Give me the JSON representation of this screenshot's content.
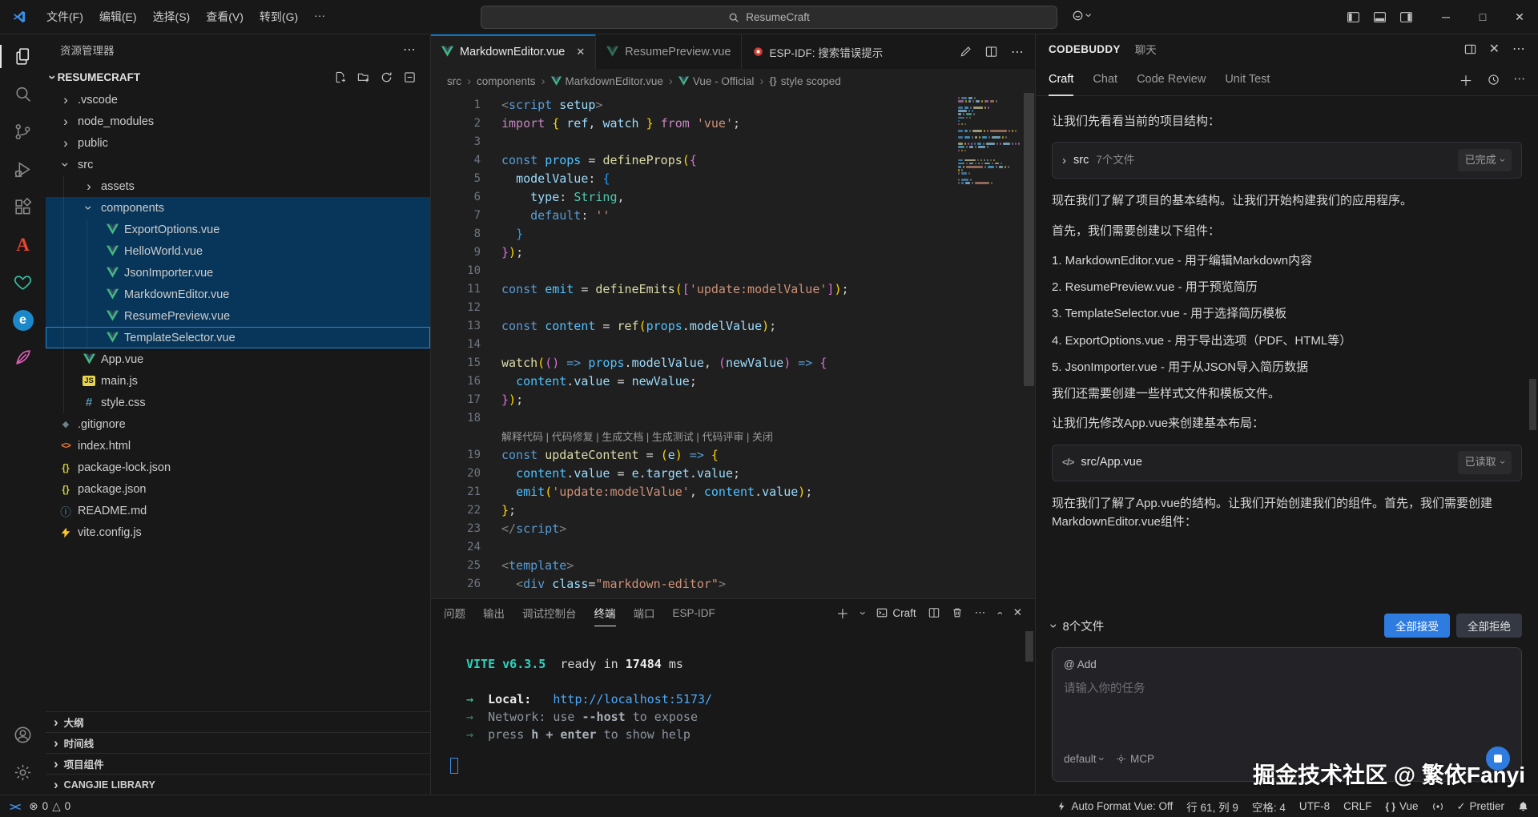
{
  "titlebar": {
    "menus": [
      "文件(F)",
      "编辑(E)",
      "选择(S)",
      "查看(V)",
      "转到(G)",
      "···"
    ],
    "search": "ResumeCraft"
  },
  "activity_bar": {
    "top": [
      {
        "name": "explorer",
        "active": true
      },
      {
        "name": "search"
      },
      {
        "name": "source-control"
      },
      {
        "name": "run-debug"
      },
      {
        "name": "extensions"
      },
      {
        "name": "tongyi-lingma"
      },
      {
        "name": "codebuddy"
      },
      {
        "name": "esp-idf"
      },
      {
        "name": "cangjie"
      }
    ],
    "bottom": [
      {
        "name": "account"
      },
      {
        "name": "settings"
      }
    ]
  },
  "sidebar": {
    "explorer_title": "资源管理器",
    "project": "RESUMECRAFT",
    "tree": [
      {
        "label": ".vscode",
        "type": "folder",
        "indent": 0
      },
      {
        "label": "node_modules",
        "type": "folder",
        "indent": 0
      },
      {
        "label": "public",
        "type": "folder",
        "indent": 0
      },
      {
        "label": "src",
        "type": "folder-open",
        "indent": 0
      },
      {
        "label": "assets",
        "type": "folder",
        "indent": 1
      },
      {
        "label": "components",
        "type": "folder-open",
        "indent": 1,
        "highlight": true
      },
      {
        "label": "ExportOptions.vue",
        "type": "vue",
        "indent": 2,
        "highlight": true
      },
      {
        "label": "HelloWorld.vue",
        "type": "vue",
        "indent": 2,
        "highlight": true
      },
      {
        "label": "JsonImporter.vue",
        "type": "vue",
        "indent": 2,
        "highlight": true
      },
      {
        "label": "MarkdownEditor.vue",
        "type": "vue",
        "indent": 2,
        "highlight": true
      },
      {
        "label": "ResumePreview.vue",
        "type": "vue",
        "indent": 2,
        "highlight": true
      },
      {
        "label": "TemplateSelector.vue",
        "type": "vue",
        "indent": 2,
        "highlight": true,
        "focused": true
      },
      {
        "label": "App.vue",
        "type": "vue",
        "indent": 1
      },
      {
        "label": "main.js",
        "type": "js",
        "indent": 1
      },
      {
        "label": "style.css",
        "type": "css",
        "indent": 1
      },
      {
        "label": ".gitignore",
        "type": "git",
        "indent": 0
      },
      {
        "label": "index.html",
        "type": "html",
        "indent": 0
      },
      {
        "label": "package-lock.json",
        "type": "json",
        "indent": 0
      },
      {
        "label": "package.json",
        "type": "json",
        "indent": 0
      },
      {
        "label": "README.md",
        "type": "info",
        "indent": 0
      },
      {
        "label": "vite.config.js",
        "type": "vite",
        "indent": 0
      }
    ],
    "sections": [
      "大纲",
      "时间线",
      "项目组件",
      "CANGJIE LIBRARY"
    ]
  },
  "editor": {
    "tabs": [
      {
        "label": "MarkdownEditor.vue",
        "active": true
      },
      {
        "label": "ResumePreview.vue",
        "active": false
      }
    ],
    "esp": "ESP-IDF: 搜索错误提示",
    "breadcrumb": [
      {
        "label": "src"
      },
      {
        "label": "components"
      },
      {
        "label": "MarkdownEditor.vue",
        "icon": "vue"
      },
      {
        "label": "Vue - Official",
        "icon": "vue"
      },
      {
        "label": "style scoped",
        "icon": "braces"
      }
    ],
    "code": [
      {
        "n": 1,
        "t": [
          [
            "p",
            "<"
          ],
          [
            "g",
            "script"
          ],
          [
            "a",
            " setup"
          ],
          [
            "p",
            ">"
          ]
        ]
      },
      {
        "n": 2,
        "t": [
          [
            "k",
            "import"
          ],
          [
            "w",
            " "
          ],
          [
            "G",
            "{"
          ],
          [
            "w",
            " "
          ],
          [
            "v",
            "ref"
          ],
          [
            "w",
            ", "
          ],
          [
            "v",
            "watch"
          ],
          [
            "w",
            " "
          ],
          [
            "G",
            "}"
          ],
          [
            "w",
            " "
          ],
          [
            "k",
            "from"
          ],
          [
            "w",
            " "
          ],
          [
            "s",
            "'vue'"
          ],
          [
            "w",
            ";"
          ]
        ]
      },
      {
        "n": 3,
        "t": []
      },
      {
        "n": 4,
        "t": [
          [
            "b",
            "const"
          ],
          [
            "w",
            " "
          ],
          [
            "c",
            "props"
          ],
          [
            "w",
            " = "
          ],
          [
            "f",
            "defineProps"
          ],
          [
            "G",
            "("
          ],
          [
            "P",
            "{"
          ]
        ]
      },
      {
        "n": 5,
        "t": [
          [
            "w",
            "  "
          ],
          [
            "v",
            "modelValue"
          ],
          [
            "w",
            ": "
          ],
          [
            "B",
            "{"
          ]
        ]
      },
      {
        "n": 6,
        "t": [
          [
            "w",
            "    "
          ],
          [
            "v",
            "type"
          ],
          [
            "w",
            ": "
          ],
          [
            "t",
            "String"
          ],
          [
            "w",
            ","
          ]
        ]
      },
      {
        "n": 7,
        "t": [
          [
            "w",
            "    "
          ],
          [
            "b",
            "default"
          ],
          [
            "w",
            ": "
          ],
          [
            "s",
            "''"
          ]
        ]
      },
      {
        "n": 8,
        "t": [
          [
            "w",
            "  "
          ],
          [
            "B",
            "}"
          ]
        ]
      },
      {
        "n": 9,
        "t": [
          [
            "P",
            "}"
          ],
          [
            "G",
            ")"
          ],
          [
            "w",
            ";"
          ]
        ]
      },
      {
        "n": 10,
        "t": []
      },
      {
        "n": 11,
        "t": [
          [
            "b",
            "const"
          ],
          [
            "w",
            " "
          ],
          [
            "c",
            "emit"
          ],
          [
            "w",
            " = "
          ],
          [
            "f",
            "defineEmits"
          ],
          [
            "G",
            "("
          ],
          [
            "P",
            "["
          ],
          [
            "s",
            "'update:modelValue'"
          ],
          [
            "P",
            "]"
          ],
          [
            "G",
            ")"
          ],
          [
            "w",
            ";"
          ]
        ]
      },
      {
        "n": 12,
        "t": []
      },
      {
        "n": 13,
        "t": [
          [
            "b",
            "const"
          ],
          [
            "w",
            " "
          ],
          [
            "c",
            "content"
          ],
          [
            "w",
            " = "
          ],
          [
            "f",
            "ref"
          ],
          [
            "G",
            "("
          ],
          [
            "c",
            "props"
          ],
          [
            "w",
            "."
          ],
          [
            "v",
            "modelValue"
          ],
          [
            "G",
            ")"
          ],
          [
            "w",
            ";"
          ]
        ]
      },
      {
        "n": 14,
        "t": []
      },
      {
        "n": 15,
        "t": [
          [
            "f",
            "watch"
          ],
          [
            "G",
            "("
          ],
          [
            "P",
            "("
          ],
          [
            "P",
            ")"
          ],
          [
            "w",
            " "
          ],
          [
            "b",
            "=>"
          ],
          [
            "w",
            " "
          ],
          [
            "c",
            "props"
          ],
          [
            "w",
            "."
          ],
          [
            "v",
            "modelValue"
          ],
          [
            "w",
            ", "
          ],
          [
            "P",
            "("
          ],
          [
            "v",
            "newValue"
          ],
          [
            "P",
            ")"
          ],
          [
            "w",
            " "
          ],
          [
            "b",
            "=>"
          ],
          [
            "w",
            " "
          ],
          [
            "P",
            "{"
          ]
        ]
      },
      {
        "n": 16,
        "t": [
          [
            "w",
            "  "
          ],
          [
            "c",
            "content"
          ],
          [
            "w",
            "."
          ],
          [
            "v",
            "value"
          ],
          [
            "w",
            " = "
          ],
          [
            "v",
            "newValue"
          ],
          [
            "w",
            ";"
          ]
        ]
      },
      {
        "n": 17,
        "t": [
          [
            "P",
            "}"
          ],
          [
            "G",
            ")"
          ],
          [
            "w",
            ";"
          ]
        ]
      },
      {
        "n": 18,
        "t": []
      },
      {
        "hint": "解释代码 | 代码修复 | 生成文档 | 生成测试 | 代码评审 | 关闭"
      },
      {
        "n": 19,
        "t": [
          [
            "b",
            "const"
          ],
          [
            "w",
            " "
          ],
          [
            "f",
            "updateContent"
          ],
          [
            "w",
            " = "
          ],
          [
            "G",
            "("
          ],
          [
            "v",
            "e"
          ],
          [
            "G",
            ")"
          ],
          [
            "w",
            " "
          ],
          [
            "b",
            "=>"
          ],
          [
            "w",
            " "
          ],
          [
            "G",
            "{"
          ]
        ]
      },
      {
        "n": 20,
        "t": [
          [
            "w",
            "  "
          ],
          [
            "c",
            "content"
          ],
          [
            "w",
            "."
          ],
          [
            "v",
            "value"
          ],
          [
            "w",
            " = "
          ],
          [
            "v",
            "e"
          ],
          [
            "w",
            "."
          ],
          [
            "v",
            "target"
          ],
          [
            "w",
            "."
          ],
          [
            "v",
            "value"
          ],
          [
            "w",
            ";"
          ]
        ]
      },
      {
        "n": 21,
        "t": [
          [
            "w",
            "  "
          ],
          [
            "c",
            "emit"
          ],
          [
            "G",
            "("
          ],
          [
            "s",
            "'update:modelValue'"
          ],
          [
            "w",
            ", "
          ],
          [
            "c",
            "content"
          ],
          [
            "w",
            "."
          ],
          [
            "v",
            "value"
          ],
          [
            "G",
            ")"
          ],
          [
            "w",
            ";"
          ]
        ]
      },
      {
        "n": 22,
        "t": [
          [
            "G",
            "}"
          ],
          [
            "w",
            ";"
          ]
        ]
      },
      {
        "n": 23,
        "t": [
          [
            "p",
            "</"
          ],
          [
            "g",
            "script"
          ],
          [
            "p",
            ">"
          ]
        ]
      },
      {
        "n": 24,
        "t": []
      },
      {
        "n": 25,
        "t": [
          [
            "p",
            "<"
          ],
          [
            "g",
            "template"
          ],
          [
            "p",
            ">"
          ]
        ]
      },
      {
        "n": 26,
        "t": [
          [
            "w",
            "  "
          ],
          [
            "p",
            "<"
          ],
          [
            "g",
            "div"
          ],
          [
            "w",
            " "
          ],
          [
            "a",
            "class"
          ],
          [
            "w",
            "="
          ],
          [
            "s",
            "\"markdown-editor\""
          ],
          [
            "p",
            ">"
          ]
        ]
      }
    ]
  },
  "panel": {
    "tabs": [
      "问题",
      "输出",
      "调试控制台",
      "终端",
      "端口",
      "ESP-IDF"
    ],
    "active_index": 3,
    "craft": "Craft",
    "terminal": [
      {
        "t": [
          [
            "vite",
            "VITE v6.3.5"
          ],
          [
            "w",
            "  ready in "
          ],
          [
            "bold",
            "17484"
          ],
          [
            "w",
            " ms"
          ]
        ]
      },
      {
        "t": []
      },
      {
        "t": [
          [
            "arrow",
            "→"
          ],
          [
            "bold",
            "  Local"
          ],
          [
            "bold",
            ":"
          ],
          [
            "w",
            "   "
          ],
          [
            "link",
            "http://localhost:5173/"
          ]
        ]
      },
      {
        "t": [
          [
            "arrowdim",
            "→"
          ],
          [
            "dim",
            "  Network"
          ],
          [
            "dim",
            ": use "
          ],
          [
            "dimb",
            "--host"
          ],
          [
            "dim",
            " to expose"
          ]
        ]
      },
      {
        "t": [
          [
            "arrowdim",
            "→"
          ],
          [
            "dim",
            "  press "
          ],
          [
            "dimb",
            "h + enter"
          ],
          [
            "dim",
            " to show help"
          ]
        ]
      }
    ]
  },
  "codebuddy": {
    "title": "CODEBUDDY",
    "chat_label": "聊天",
    "tabs": [
      {
        "label": "Craft",
        "active": true
      },
      {
        "label": "Chat"
      },
      {
        "label": "Code Review"
      },
      {
        "label": "Unit Test"
      }
    ],
    "messages": [
      {
        "t": "p",
        "text": "让我们先看看当前的项目结构："
      },
      {
        "t": "card",
        "icon": "chevron",
        "title": "src",
        "meta": "7个文件",
        "badge": "已完成"
      },
      {
        "t": "p",
        "text": "现在我们了解了项目的基本结构。让我们开始构建我们的应用程序。"
      },
      {
        "t": "p",
        "text": "首先，我们需要创建以下组件："
      },
      {
        "t": "li",
        "text": "1. MarkdownEditor.vue - 用于编辑Markdown内容"
      },
      {
        "t": "li",
        "text": "2. ResumePreview.vue - 用于预览简历"
      },
      {
        "t": "li",
        "text": "3. TemplateSelector.vue - 用于选择简历模板"
      },
      {
        "t": "li",
        "text": "4. ExportOptions.vue - 用于导出选项（PDF、HTML等）"
      },
      {
        "t": "li",
        "text": "5. JsonImporter.vue - 用于从JSON导入简历数据"
      },
      {
        "t": "p",
        "text": "我们还需要创建一些样式文件和模板文件。"
      },
      {
        "t": "p",
        "text": "让我们先修改App.vue来创建基本布局："
      },
      {
        "t": "card",
        "icon": "code",
        "title": "src/App.vue",
        "meta": "",
        "badge": "已读取"
      },
      {
        "t": "p",
        "text": "现在我们了解了App.vue的结构。让我们开始创建我们的组件。首先，我们需要创建MarkdownEditor.vue组件："
      }
    ],
    "footer": {
      "files_label": "8个文件",
      "accept": "全部接受",
      "reject": "全部拒绝"
    },
    "input": {
      "add_label": "@ Add",
      "placeholder": "请输入你的任务",
      "model": "default",
      "mcp": "MCP"
    }
  },
  "status_bar": {
    "errors": "0",
    "warnings": "0",
    "right": [
      {
        "icon": "zap",
        "label": "Auto Format Vue: Off"
      },
      {
        "label": "行 61, 列 9"
      },
      {
        "label": "空格: 4"
      },
      {
        "label": "UTF-8"
      },
      {
        "label": "CRLF"
      },
      {
        "icon": "braces",
        "label": "Vue"
      },
      {
        "icon": "broadcast",
        "label": ""
      },
      {
        "icon": "check",
        "label": "Prettier"
      },
      {
        "icon": "bell",
        "label": ""
      }
    ]
  },
  "watermark": {
    "text": "掘金技术社区 @ 繁依Fanyi"
  }
}
